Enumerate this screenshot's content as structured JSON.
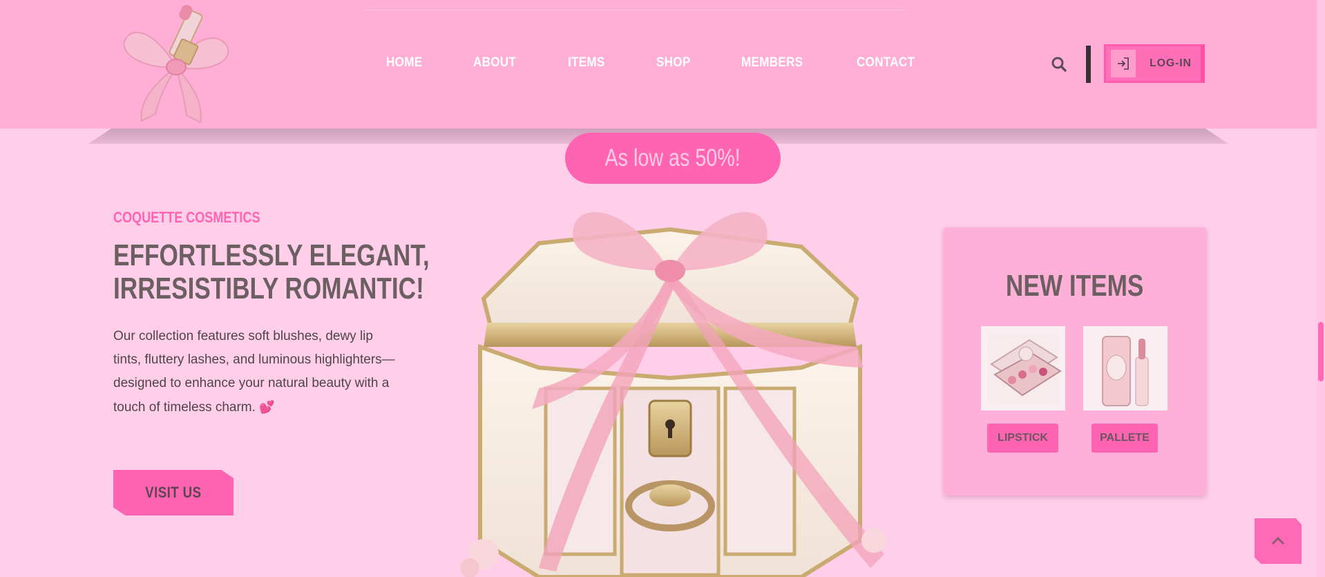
{
  "nav": {
    "items": [
      {
        "label": "HOME"
      },
      {
        "label": "ABOUT"
      },
      {
        "label": "ITEMS"
      },
      {
        "label": "SHOP"
      },
      {
        "label": "MEMBERS"
      },
      {
        "label": "CONTACT"
      }
    ],
    "login_label": "LOG-IN"
  },
  "promo": {
    "text": "As low as 50%!"
  },
  "hero": {
    "eyebrow": "COQUETTE COSMETICS",
    "headline_line1": "EFFORTLESSLY ELEGANT,",
    "headline_line2": "IRRESISTIBLY ROMANTIC!",
    "body": "Our collection features soft blushes, dewy lip tints, fluttery lashes, and luminous highlighters—designed to enhance your natural beauty with a touch of timeless charm.",
    "heart_emoji": "💕",
    "cta_label": "VISIT US"
  },
  "new_items": {
    "title": "NEW ITEMS",
    "products": [
      {
        "button": "LIPSTICK"
      },
      {
        "button": "PALLETE"
      }
    ]
  },
  "icons": {
    "logo": "bow-lipstick-logo",
    "search": "search-icon",
    "login": "login-icon",
    "scroll_top": "chevron-up-icon"
  },
  "colors": {
    "header_bg": "#ffaed6",
    "page_bg": "#ffcfea",
    "accent": "#ff64b3",
    "heading_text": "#6b5f62"
  }
}
